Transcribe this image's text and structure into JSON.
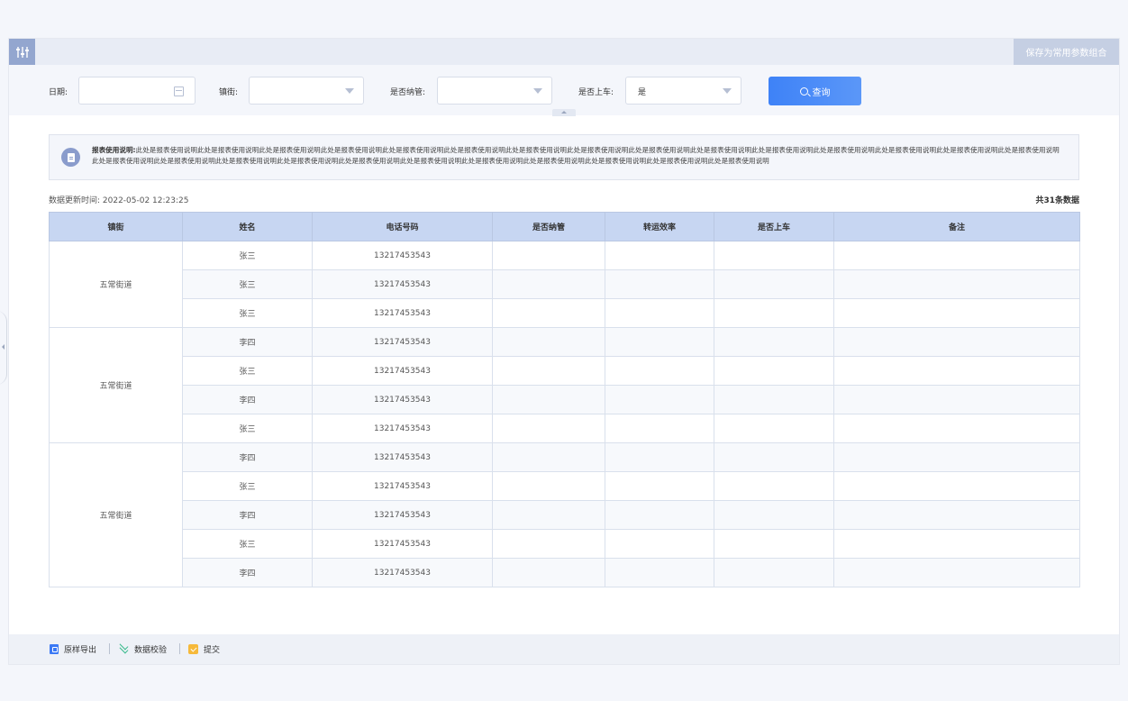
{
  "topbar": {
    "toggle_icon": "sliders-icon",
    "save_label": "保存为常用参数组合"
  },
  "filters": {
    "date_label": "日期:",
    "date_value": "",
    "street_label": "镇街:",
    "street_value": "",
    "managed_label": "是否纳管:",
    "managed_value": "",
    "onboard_label": "是否上车:",
    "onboard_value": "是",
    "search_label": "查询"
  },
  "notice": {
    "title": "报表使用说明:",
    "text": "此处是报表使用说明此处是报表使用说明此处是报表使用说明此处是报表使用说明此处是报表使用说明此处是报表使用说明此处是报表使用说明此处是报表使用说明此处是报表使用说明此处是报表使用说明此处是报表使用说明此处是报表使用说明此处是报表使用说明此处是报表使用说明此处是报表使用说明此处是报表使用说明此处是报表使用说明此处是报表使用说明此处是报表使用说明此处是报表使用说明此处是报表使用说明此处是报表使用说明此处是报表使用说明此处是报表使用说明此处是报表使用说明此处是报表使用说明"
  },
  "meta": {
    "updated": "数据更新时间: 2022-05-02 12:23:25",
    "total": "共31条数据"
  },
  "table": {
    "headers": [
      "镇街",
      "姓名",
      "电话号码",
      "是否纳管",
      "转运效率",
      "是否上车",
      "备注"
    ],
    "groups": [
      {
        "street": "五常街道",
        "rows": [
          [
            "张三",
            "13217453543"
          ],
          [
            "张三",
            "13217453543"
          ],
          [
            "张三",
            "13217453543"
          ]
        ]
      },
      {
        "street": "五常街道",
        "rows": [
          [
            "李四",
            "13217453543"
          ],
          [
            "张三",
            "13217453543"
          ],
          [
            "李四",
            "13217453543"
          ],
          [
            "张三",
            "13217453543"
          ]
        ]
      },
      {
        "street": "五常街道",
        "rows": [
          [
            "李四",
            "13217453543"
          ],
          [
            "张三",
            "13217453543"
          ],
          [
            "李四",
            "13217453543"
          ],
          [
            "张三",
            "13217453543"
          ],
          [
            "李四",
            "13217453543"
          ]
        ]
      }
    ]
  },
  "footer": {
    "export_label": "原样导出",
    "validate_label": "数据校验",
    "submit_label": "提交"
  }
}
